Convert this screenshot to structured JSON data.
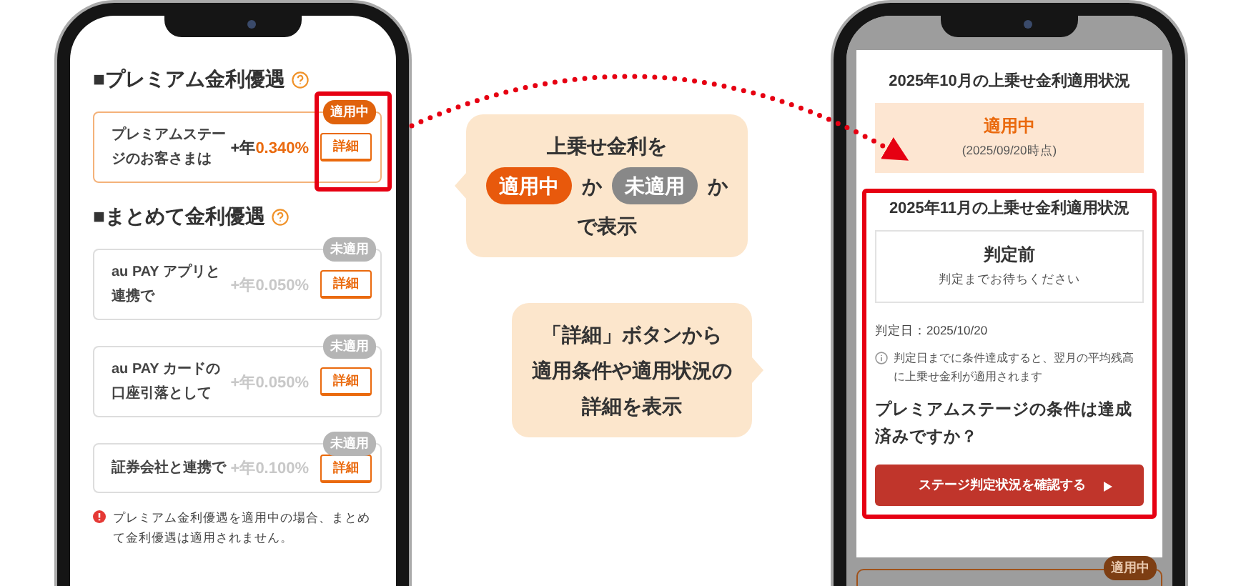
{
  "left_phone": {
    "sections": [
      {
        "title": "■プレミアム金利優遇",
        "items": [
          {
            "label": "プレミアムステージのお客さまは",
            "rate_prefix": "+年",
            "rate_value": "0.340%",
            "status": "適用中",
            "applied": true,
            "button": "詳細",
            "highlighted": true
          }
        ]
      },
      {
        "title": "■まとめて金利優遇",
        "items": [
          {
            "label": "au PAY アプリと連携で",
            "rate_prefix": "+年",
            "rate_value": "0.050%",
            "status": "未適用",
            "applied": false,
            "button": "詳細",
            "highlighted": false
          },
          {
            "label": "au PAY カードの口座引落として",
            "rate_prefix": "+年",
            "rate_value": "0.050%",
            "status": "未適用",
            "applied": false,
            "button": "詳細",
            "highlighted": false
          },
          {
            "label": "証券会社と連携で",
            "rate_prefix": "+年",
            "rate_value": "0.100%",
            "status": "未適用",
            "applied": false,
            "button": "詳細",
            "highlighted": false
          }
        ]
      }
    ],
    "notice": "プレミアム金利優遇を適用中の場合、まとめて金利優遇は適用されません。"
  },
  "callouts": [
    {
      "kind": "legend",
      "lines": [
        [
          {
            "kind": "text",
            "text": "上乗せ金利を"
          }
        ],
        [
          {
            "kind": "pill",
            "text": "適用中",
            "applied": true
          },
          {
            "kind": "text",
            "text": "か"
          },
          {
            "kind": "pill",
            "text": "未適用",
            "applied": false
          },
          {
            "kind": "text",
            "text": "か"
          }
        ],
        [
          {
            "kind": "text",
            "text": "で表示"
          }
        ]
      ]
    },
    {
      "kind": "plain",
      "lines": [
        [
          {
            "kind": "text",
            "text": "「詳細」ボタンから"
          }
        ],
        [
          {
            "kind": "text",
            "text": "適用条件や適用状況の"
          }
        ],
        [
          {
            "kind": "text",
            "text": "詳細を表示"
          }
        ]
      ]
    }
  ],
  "right_phone": {
    "months": [
      {
        "title": "2025年10月の上乗せ金利適用状況",
        "status": "適用中",
        "note": "(2025/09/20時点)",
        "kind": "applied",
        "highlighted": false
      },
      {
        "title": "2025年11月の上乗せ金利適用状況",
        "status": "判定前",
        "note": "判定までお待ちください",
        "kind": "pending",
        "highlighted": true,
        "judgement_date": "判定日：2025/10/20",
        "info": "判定日までに条件達成すると、翌月の平均残高に上乗せ金利が適用されます",
        "question": "プレミアムステージの条件は達成済みですか？",
        "cta": "ステージ判定状況を確認する"
      }
    ],
    "peek_badge": "適用中"
  }
}
